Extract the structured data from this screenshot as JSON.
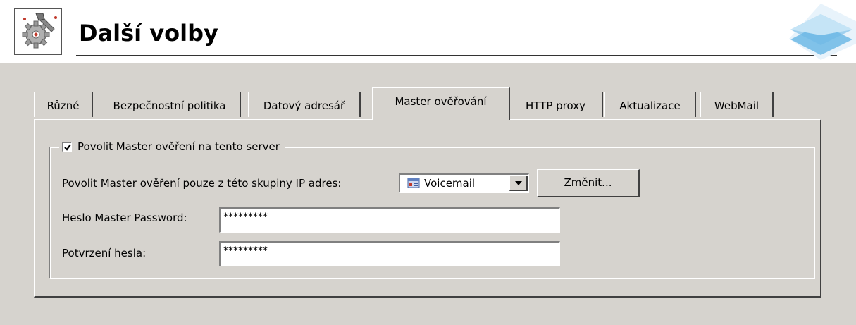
{
  "page": {
    "title": "Další volby",
    "icon": "settings-gear-icon",
    "corner_decoration": "blue-layers-logo"
  },
  "tabs": [
    {
      "label": "Různé",
      "active": false
    },
    {
      "label": "Bezpečnostní politika",
      "active": false
    },
    {
      "label": "Datový adresář",
      "active": false
    },
    {
      "label": "Master ověřování",
      "active": true
    },
    {
      "label": "HTTP proxy",
      "active": false
    },
    {
      "label": "Aktualizace",
      "active": false
    },
    {
      "label": "WebMail",
      "active": false
    }
  ],
  "master_auth": {
    "enable_label": "Povolit Master ověření na tento server",
    "enable_checked": true,
    "ip_group_label": "Povolit Master ověření pouze z této skupiny IP adres:",
    "ip_group_value": "Voicemail",
    "change_button": "Změnit...",
    "password_label": "Heslo Master Password:",
    "password_value": "*********",
    "confirm_label": "Potvrzení hesla:",
    "confirm_value": "*********"
  },
  "colors": {
    "panel": "#d6d3ce",
    "accent": "#4aa3d8"
  }
}
